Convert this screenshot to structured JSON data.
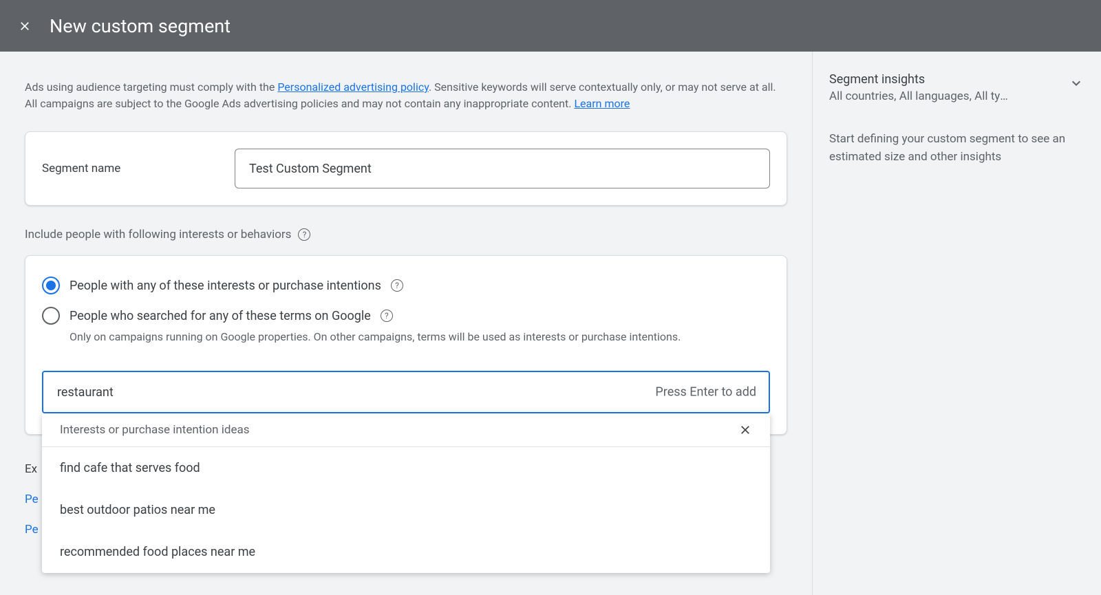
{
  "header": {
    "title": "New custom segment"
  },
  "notice": {
    "text1": "Ads using audience targeting must comply with the ",
    "link1": "Personalized advertising policy",
    "text2": ". Sensitive keywords will serve contextually only, or may not serve at all. All campaigns are subject to the Google Ads advertising policies and may not contain any inappropriate content. ",
    "link2": "Learn more"
  },
  "segmentName": {
    "label": "Segment name",
    "value": "Test Custom Segment"
  },
  "includeLabel": "Include people with following interests or behaviors",
  "options": {
    "opt1": "People with any of these interests or purchase intentions",
    "opt2": "People who searched for any of these terms on Google",
    "opt2sub": "Only on campaigns running on Google properties. On other campaigns, terms will be used as interests or purchase intentions."
  },
  "search": {
    "value": "restaurant",
    "hint": "Press Enter to add"
  },
  "dropdown": {
    "header": "Interests or purchase intention ideas",
    "items": [
      "find cafe that serves food",
      "best outdoor patios near me",
      "recommended food places near me"
    ]
  },
  "expand": "Ex",
  "partial1": "Pe",
  "partial2": "Pe",
  "insights": {
    "title": "Segment insights",
    "sub": "All countries, All languages, All typ…",
    "desc": "Start defining your custom segment to see an estimated size and other insights"
  }
}
